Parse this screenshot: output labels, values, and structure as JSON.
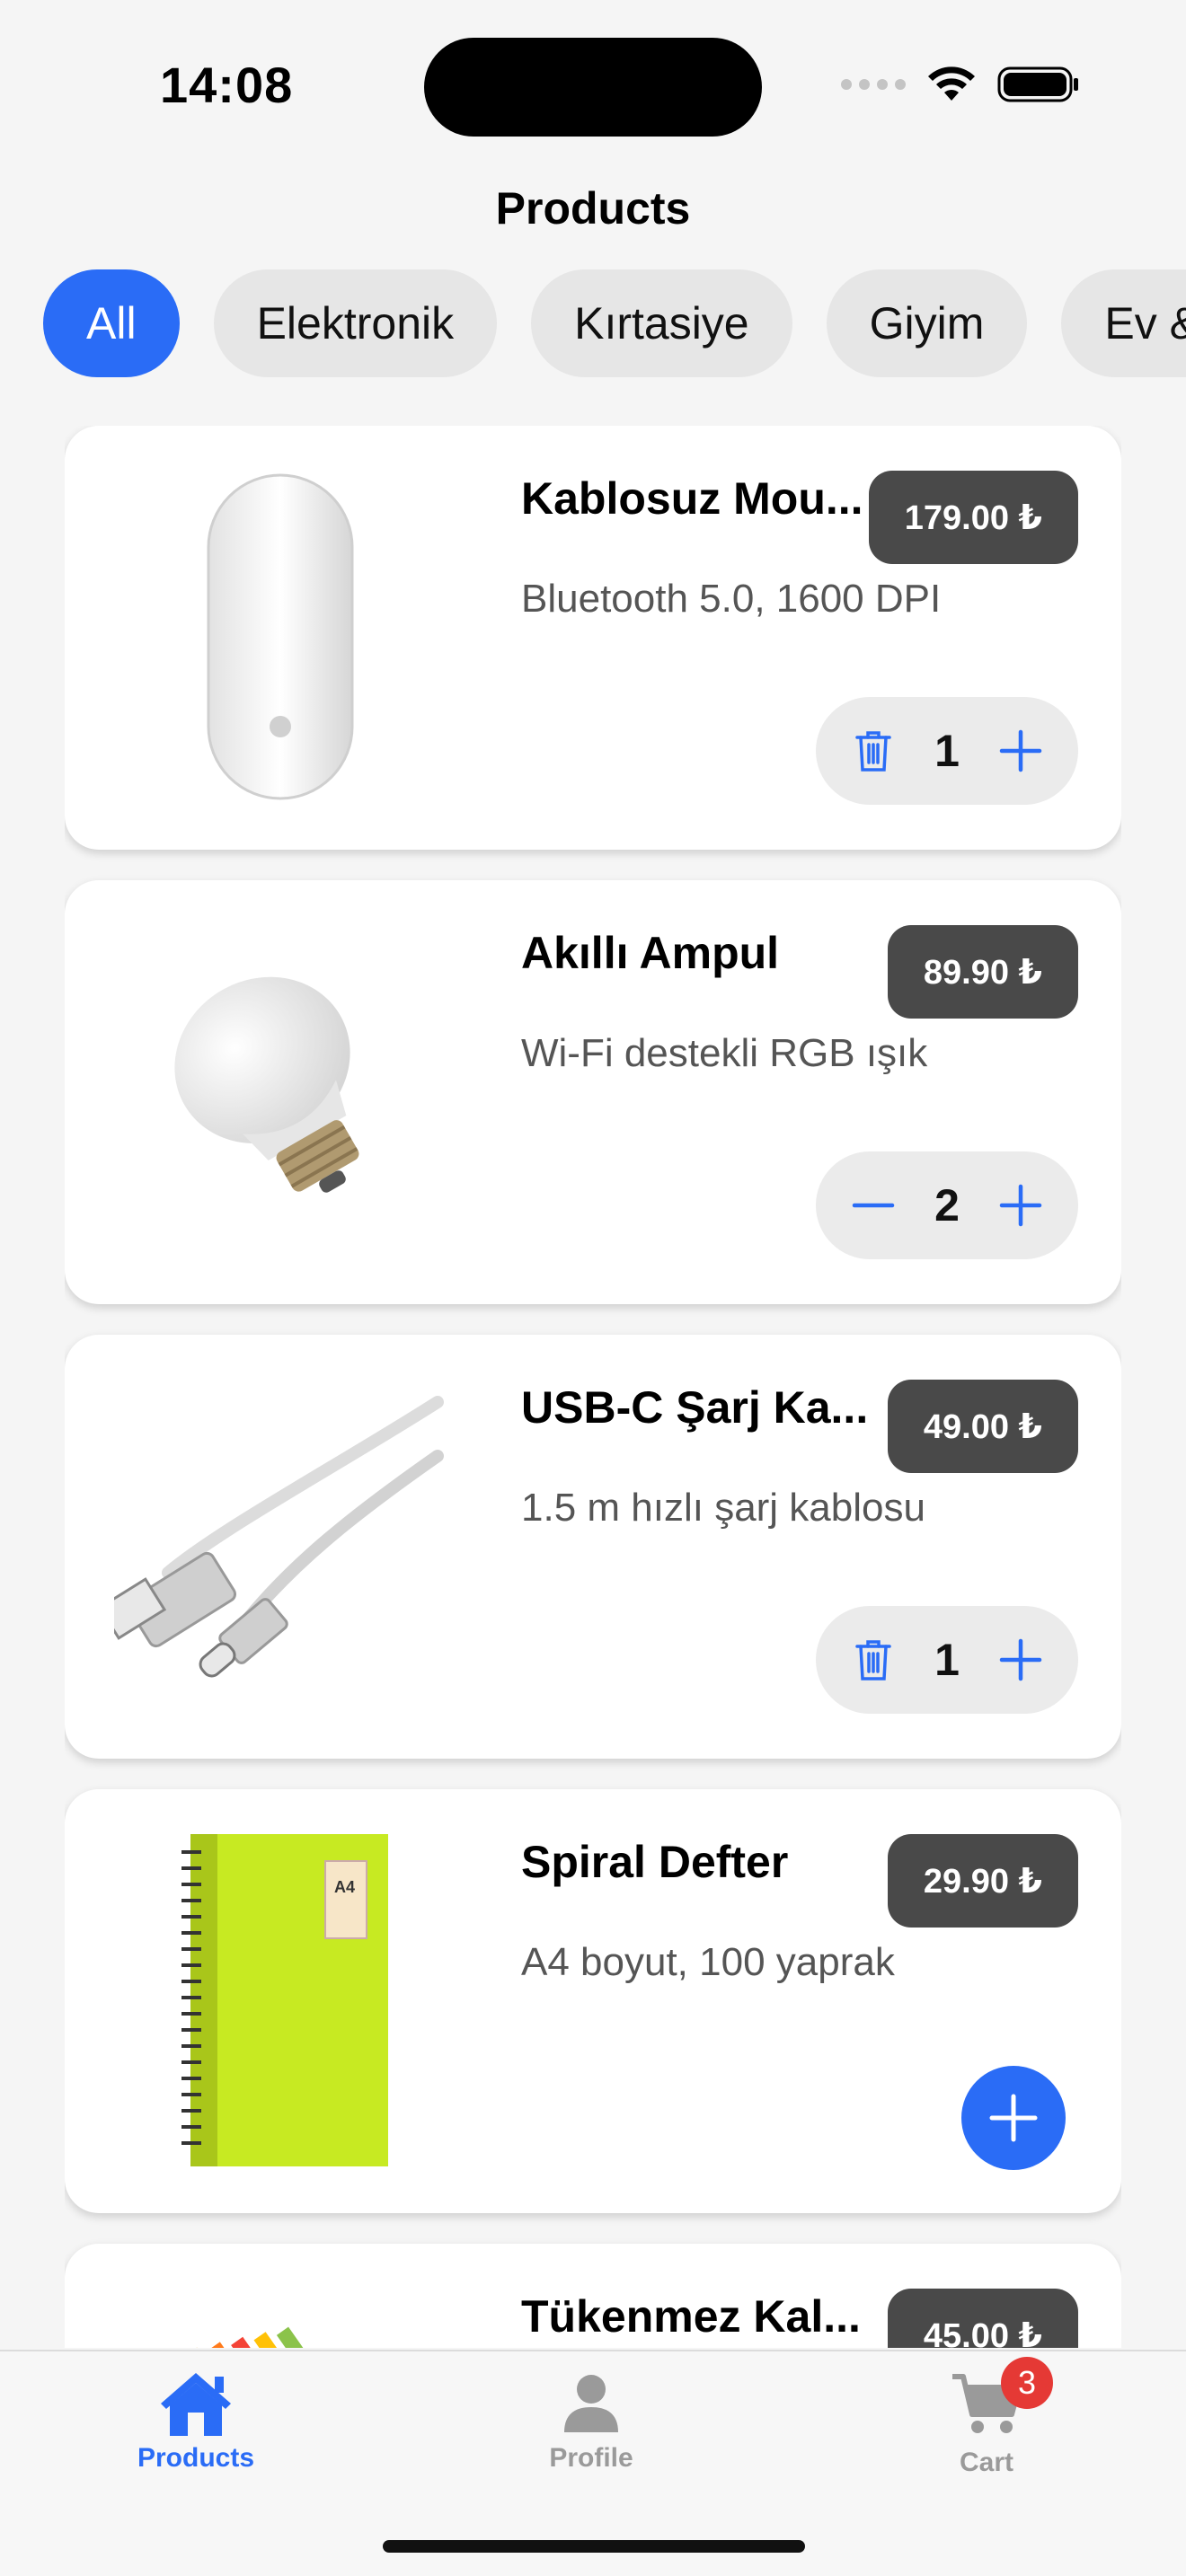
{
  "status_bar": {
    "time": "14:08"
  },
  "header": {
    "title": "Products"
  },
  "categories": [
    {
      "label": "All",
      "active": true
    },
    {
      "label": "Elektronik",
      "active": false
    },
    {
      "label": "Kırtasiye",
      "active": false
    },
    {
      "label": "Giyim",
      "active": false
    },
    {
      "label": "Ev &",
      "active": false
    }
  ],
  "products": [
    {
      "name": "Kablosuz Mou...",
      "price": "179.00 ₺",
      "description": "Bluetooth 5.0, 1600 DPI",
      "quantity": "1",
      "image": "mouse"
    },
    {
      "name": "Akıllı Ampul",
      "price": "89.90 ₺",
      "description": "Wi-Fi destekli RGB ışık",
      "quantity": "2",
      "image": "bulb"
    },
    {
      "name": "USB-C Şarj Ka...",
      "price": "49.00 ₺",
      "description": "1.5 m hızlı şarj kablosu",
      "quantity": "1",
      "image": "cable"
    },
    {
      "name": "Spiral Defter",
      "price": "29.90 ₺",
      "description": "A4 boyut, 100 yaprak",
      "quantity": "0",
      "image": "notebook"
    },
    {
      "name": "Tükenmez Kal...",
      "price": "45.00 ₺",
      "description": "",
      "quantity": "0",
      "image": "pens"
    }
  ],
  "tab_bar": {
    "items": [
      {
        "label": "Products",
        "icon": "home-icon",
        "active": true
      },
      {
        "label": "Profile",
        "icon": "person-icon",
        "active": false
      },
      {
        "label": "Cart",
        "icon": "cart-icon",
        "active": false
      }
    ],
    "cart_badge": "3"
  },
  "colors": {
    "accent": "#2a6cf6",
    "price_badge": "#494949",
    "badge": "#e53935"
  }
}
